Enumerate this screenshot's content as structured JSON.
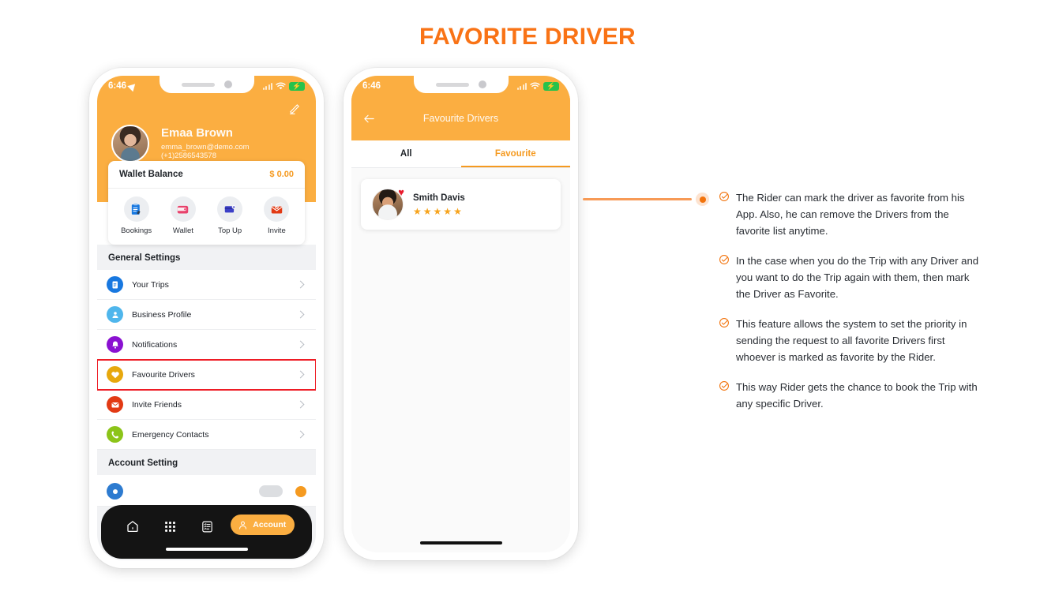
{
  "page": {
    "title": "FAVORITE DRIVER",
    "accent": "#F97316",
    "header_orange": "#FBAE41",
    "highlight_red": "#EE1C25"
  },
  "phone1": {
    "status": {
      "time": "6:46",
      "location_icon": "location-arrow-icon",
      "signal_icon": "signal-dots-icon",
      "wifi_icon": "wifi-icon",
      "battery_icon": "battery-charging-icon"
    },
    "edit_icon": "pencil-edit-icon",
    "profile": {
      "avatar": "user-avatar",
      "name": "Emaa Brown",
      "email": "emma_brown@demo.com",
      "phone": "(+1)2586543578"
    },
    "wallet": {
      "label": "Wallet Balance",
      "amount": "$ 0.00",
      "actions": [
        {
          "label": "Bookings",
          "icon": "clipboard-bookings-icon"
        },
        {
          "label": "Wallet",
          "icon": "wallet-icon"
        },
        {
          "label": "Top Up",
          "icon": "topup-card-icon"
        },
        {
          "label": "Invite",
          "icon": "envelope-invite-icon"
        }
      ]
    },
    "general_settings_title": "General Settings",
    "settings": [
      {
        "label": "Your Trips",
        "icon": "trips-icon",
        "color": "#1878E0",
        "highlighted": false
      },
      {
        "label": "Business Profile",
        "icon": "business-profile-icon",
        "color": "#4FB6EC",
        "highlighted": false
      },
      {
        "label": "Notifications",
        "icon": "bell-icon",
        "color": "#8A11D1",
        "highlighted": false
      },
      {
        "label": "Favourite Drivers",
        "icon": "heart-icon",
        "color": "#E7A80D",
        "highlighted": true
      },
      {
        "label": "Invite Friends",
        "icon": "invite-friends-icon",
        "color": "#E23A14",
        "highlighted": false
      },
      {
        "label": "Emergency Contacts",
        "icon": "phone-emergency-icon",
        "color": "#8CC419",
        "highlighted": false
      }
    ],
    "account_setting_title": "Account Setting",
    "bottom_nav": [
      {
        "name": "home",
        "icon": "home-icon",
        "label": ""
      },
      {
        "name": "grid",
        "icon": "grid-apps-icon",
        "label": ""
      },
      {
        "name": "list",
        "icon": "list-checklist-icon",
        "label": ""
      },
      {
        "name": "account",
        "icon": "account-person-icon",
        "label": "Account"
      }
    ]
  },
  "phone2": {
    "status": {
      "time": "6:46",
      "signal_icon": "signal-dots-icon",
      "wifi_icon": "wifi-icon",
      "battery_icon": "battery-charging-icon"
    },
    "back_icon": "back-arrow-icon",
    "title": "Favourite Drivers",
    "tabs": [
      {
        "label": "All",
        "active": false
      },
      {
        "label": "Favourite",
        "active": true
      }
    ],
    "drivers": [
      {
        "name": "Smith Davis",
        "rating": 5,
        "avatar": "driver-avatar",
        "favorite_icon": "heart-filled-icon"
      }
    ]
  },
  "callout": {
    "connector_color": "#F79A56",
    "dot_color": "#F2730C",
    "bullet_icon": "circle-check-icon",
    "bullets": [
      "The Rider can mark the driver as favorite from his App. Also, he can remove the Drivers from the favorite list anytime.",
      "In the case when you do the Trip with any Driver and you want to do the Trip again with them, then mark the Driver as Favorite.",
      "This feature allows the system to set the priority in sending the request to all favorite Drivers first whoever is marked as favorite by the Rider.",
      "This way Rider gets the chance to book the Trip with any specific Driver."
    ]
  }
}
